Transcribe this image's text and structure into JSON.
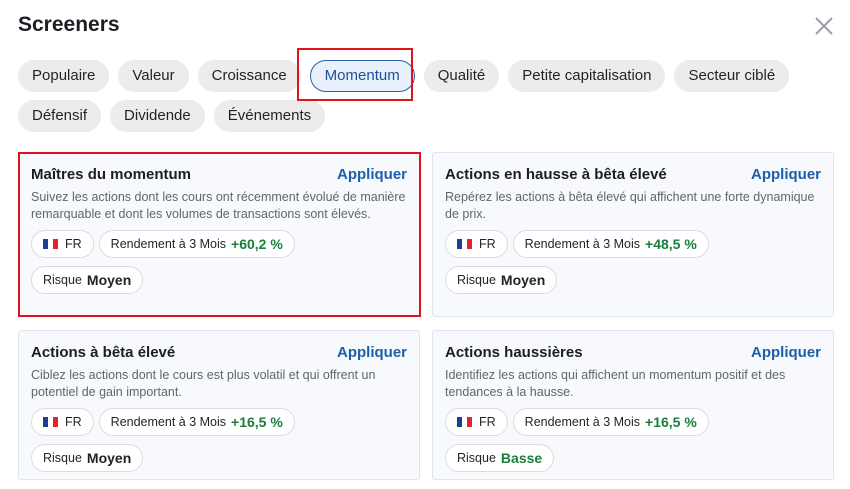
{
  "header": {
    "title": "Screeners",
    "close_icon": "close-icon"
  },
  "chips": {
    "row1": [
      "Populaire",
      "Valeur",
      "Croissance",
      "Momentum",
      "Qualité",
      "Petite capitalisation",
      "Secteur ciblé"
    ],
    "row2": [
      "Défensif",
      "Dividende",
      "Événements"
    ],
    "selected": "Momentum"
  },
  "colors": {
    "accent": "#1d5fa8",
    "positive": "#1a7d3a",
    "highlight": "#e0121b"
  },
  "cards": [
    {
      "title": "Maîtres du momentum",
      "apply": "Appliquer",
      "description": "Suivez les actions dont les cours ont récemment évolué de manière remarquable et dont les volumes de transactions sont élevés.",
      "country": "FR",
      "return_label": "Rendement à 3 Mois",
      "return_value": "+60,2 %",
      "risk_label": "Risque",
      "risk_value": "Moyen"
    },
    {
      "title": "Actions en hausse à bêta élevé",
      "apply": "Appliquer",
      "description": "Repérez les actions à bêta élevé qui affichent une forte dynamique de prix.",
      "country": "FR",
      "return_label": "Rendement à 3 Mois",
      "return_value": "+48,5 %",
      "risk_label": "Risque",
      "risk_value": "Moyen"
    },
    {
      "title": "Actions à bêta élevé",
      "apply": "Appliquer",
      "description": "Ciblez les actions dont le cours est plus volatil et qui offrent un potentiel de gain important.",
      "country": "FR",
      "return_label": "Rendement à 3 Mois",
      "return_value": "+16,5 %",
      "risk_label": "Risque",
      "risk_value": "Moyen"
    },
    {
      "title": "Actions haussières",
      "apply": "Appliquer",
      "description": "Identifiez les actions qui affichent un momentum positif et des tendances à la hausse.",
      "country": "FR",
      "return_label": "Rendement à 3 Mois",
      "return_value": "+16,5 %",
      "risk_label": "Risque",
      "risk_value": "Basse"
    }
  ]
}
